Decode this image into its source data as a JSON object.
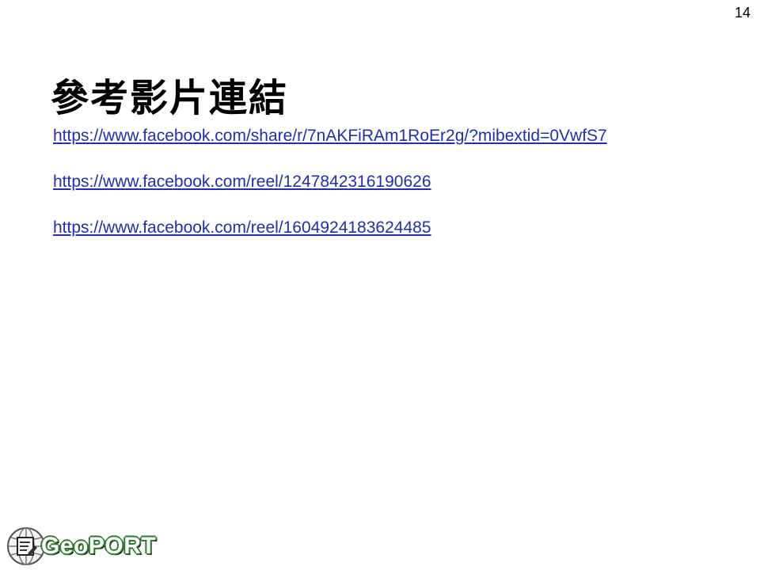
{
  "slide": {
    "page_number": "14",
    "title": "參考影片連結",
    "links": [
      "https://www.facebook.com/share/r/7nAKFiRAm1RoEr2g/?mibextid=0VwfS7",
      "https://www.facebook.com/reel/1247842316190626",
      "https://www.facebook.com/reel/1604924183624485"
    ],
    "link_color": "#1f2fb0"
  },
  "footer": {
    "logo_text": "GeoPORT",
    "logo_icon": "globe-icon"
  }
}
